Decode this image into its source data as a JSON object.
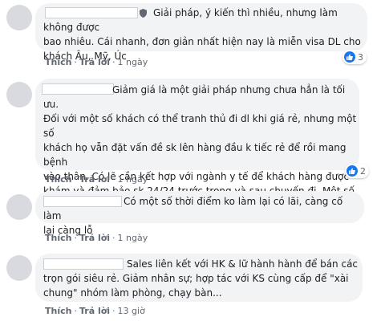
{
  "comments": [
    {
      "text": "Giải pháp, ý kiến thì nhiều, nhưng làm không được\nbao nhiêu. Cái nhanh, đơn giản nhất hiện nay là miễn visa DL cho\nkhách Âu, Mỹ, Úc",
      "like_label": "Thích",
      "reply_label": "Trả lời",
      "time": "1 ngày",
      "reaction_count": "3"
    },
    {
      "text": "Giảm giá là một giải pháp nhưng chưa hẳn là tối ưu.\nĐối với một số khách có thể tranh thủ đi dl khi giá rẻ, nhưng một số\nkhách họ vẫn đặt vấn đề sk lên hàng đầu k tiếc rẻ để rồi mang bệnh\nvào thân. Có lẽ cần kết hợp với ngành y tế để khách hàng được\nkhám và đảm bảo sk 24/24 trước trong và sau chuyến đi. Một số\nbiện pháp phòng ngừa + giảm giá tại các vùng an toàn.",
      "like_label": "Thích",
      "reply_label": "Trả lời",
      "time": "1 ngày",
      "reaction_count": "2"
    },
    {
      "text": "Có một số thời điểm ko làm lại có lãi, càng cố làm\nlại càng lỗ",
      "like_label": "Thích",
      "reply_label": "Trả lời",
      "time": "1 ngày"
    },
    {
      "text": "Sales liên kết với HK & lữ hành hành để bán các\ntrọn gói siêu rẻ. Giảm nhân sự; hợp tác với KS cùng cấp để \"xài\nchung\" nhóm làm phòng, chạy bàn...",
      "like_label": "Thích",
      "reply_label": "Trả lời",
      "time": "13 giờ"
    }
  ],
  "colors": {
    "bubble": "#f2f3f5",
    "accent": "#1877f2",
    "meta": "#606770"
  }
}
